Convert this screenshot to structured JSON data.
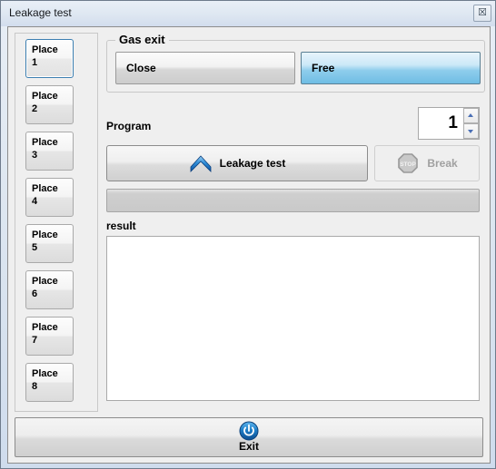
{
  "window": {
    "title": "Leakage test",
    "close_label": "☒"
  },
  "sidebar": {
    "items": [
      {
        "line1": "Place",
        "line2": "1",
        "selected": true
      },
      {
        "line1": "Place",
        "line2": "2",
        "selected": false
      },
      {
        "line1": "Place",
        "line2": "3",
        "selected": false
      },
      {
        "line1": "Place",
        "line2": "4",
        "selected": false
      },
      {
        "line1": "Place",
        "line2": "5",
        "selected": false
      },
      {
        "line1": "Place",
        "line2": "6",
        "selected": false
      },
      {
        "line1": "Place",
        "line2": "7",
        "selected": false
      },
      {
        "line1": "Place",
        "line2": "8",
        "selected": false
      }
    ]
  },
  "gas_exit": {
    "group_title": "Gas exit",
    "close_label": "Close",
    "free_label": "Free",
    "selected": "Free",
    "selected_color": "#6fbde4"
  },
  "program": {
    "label": "Program",
    "value": "1",
    "spin_up_icon": "triangle-up-icon",
    "spin_down_icon": "triangle-down-icon"
  },
  "actions": {
    "leakage_test_label": "Leakage test",
    "leakage_test_icon": "blue-chevron-up-icon",
    "break_label": "Break",
    "break_icon": "stop-octagon-icon",
    "break_enabled": false,
    "break_disabled_color": "#a0a0a0"
  },
  "progress": {
    "percent": 0
  },
  "result": {
    "label": "result",
    "text": ""
  },
  "footer": {
    "exit_label": "Exit",
    "exit_icon": "power-icon"
  }
}
